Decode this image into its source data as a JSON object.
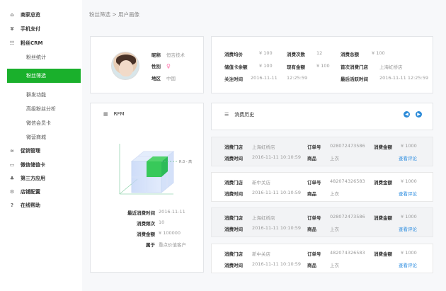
{
  "sidebar": {
    "items": [
      {
        "label": "商家总览",
        "icon": "⌂",
        "type": "bold"
      },
      {
        "label": "手机支付",
        "icon": "¥",
        "type": "bold"
      },
      {
        "label": "粉丝CRM",
        "icon": "☷",
        "type": "bold"
      },
      {
        "label": "粉丝统计",
        "icon": "",
        "type": "sub"
      },
      {
        "label": "粉丝筛选",
        "icon": "",
        "type": "active"
      },
      {
        "label": "群发功能",
        "icon": "",
        "type": "sub"
      },
      {
        "label": "高级粉丝分析",
        "icon": "",
        "type": "sub"
      },
      {
        "label": "微信会员卡",
        "icon": "",
        "type": "sub"
      },
      {
        "label": "微营商城",
        "icon": "",
        "type": "sub"
      },
      {
        "label": "促销管理",
        "icon": "≈",
        "type": "bold"
      },
      {
        "label": "微信储值卡",
        "icon": "▭",
        "type": "bold"
      },
      {
        "label": "第三方应用",
        "icon": "♣",
        "type": "bold"
      },
      {
        "label": "店铺配置",
        "icon": "⚙",
        "type": "bold"
      },
      {
        "label": "在线帮助",
        "icon": "?",
        "type": "bold"
      }
    ]
  },
  "breadcrumb": "粉丝筛选 > 用户画像",
  "profile": {
    "nickname_label": "昵称",
    "nickname": "恒吉技术",
    "gender_label": "性别",
    "gender_icon": "♀",
    "region_label": "地区",
    "region": "中国"
  },
  "stats": {
    "spend_avg_label": "消费均价",
    "spend_avg": "¥ 100",
    "spend_count_label": "消费次数",
    "spend_count": "12",
    "spend_total_label": "消费总额",
    "spend_total": "¥ 100",
    "balance_label": "储值卡余额",
    "balance": "¥ 100",
    "points_label": "现有金额",
    "points": "¥ 100",
    "first_store_label": "首次消费门店",
    "first_store": "上海虹桥店",
    "follow_time_label": "关注时间",
    "follow_date": "2016-11-11",
    "follow_time": "12:25:59",
    "last_active_label": "最后活跃时间",
    "last_active": "2016-11-11 12:25:59"
  },
  "rfm": {
    "title": "RFM",
    "chart_label": "R:3 - 高",
    "last_time_label": "最近消费时间",
    "last_time": "2016-11-11",
    "frequency_label": "消费频次",
    "frequency": "10",
    "amount_label": "消费金额",
    "amount": "¥ 100000",
    "segment_label": "属于",
    "segment": "重点价值客户"
  },
  "history": {
    "title": "消费历史",
    "prev_icon": "◀",
    "next_icon": "▶",
    "records": [
      {
        "store_label": "消费门店",
        "store": "上海虹桥店",
        "time_label": "消费时间",
        "time": "2016-11-11 10:10:59",
        "order_label": "订单号",
        "order": "028072473586",
        "product_label": "商品",
        "product": "上衣",
        "amount_label": "消费金额",
        "amount": "¥ 1000",
        "link": "查看评论"
      },
      {
        "store_label": "消费门店",
        "store": "新中关店",
        "time_label": "消费时间",
        "time": "2016-11-11 10:10:59",
        "order_label": "订单号",
        "order": "482074326583",
        "product_label": "商品",
        "product": "上衣",
        "amount_label": "消费金额",
        "amount": "¥ 1000",
        "link": "查看评论"
      },
      {
        "store_label": "消费门店",
        "store": "上海虹桥店",
        "time_label": "消费时间",
        "time": "2016-11-11 10:10:59",
        "order_label": "订单号",
        "order": "028072473586",
        "product_label": "商品",
        "product": "上衣",
        "amount_label": "消费金额",
        "amount": "¥ 1000",
        "link": "查看评论"
      },
      {
        "store_label": "消费门店",
        "store": "新中关店",
        "time_label": "消费时间",
        "time": "2016-11-11 10:10:59",
        "order_label": "订单号",
        "order": "482074326583",
        "product_label": "商品",
        "product": "上衣",
        "amount_label": "消费金额",
        "amount": "¥ 1000",
        "link": "查看评论"
      }
    ]
  },
  "colors": {
    "active_nav": "#1ab02c",
    "link": "#2b8ce0",
    "accent_button": "#2d8bd8"
  }
}
